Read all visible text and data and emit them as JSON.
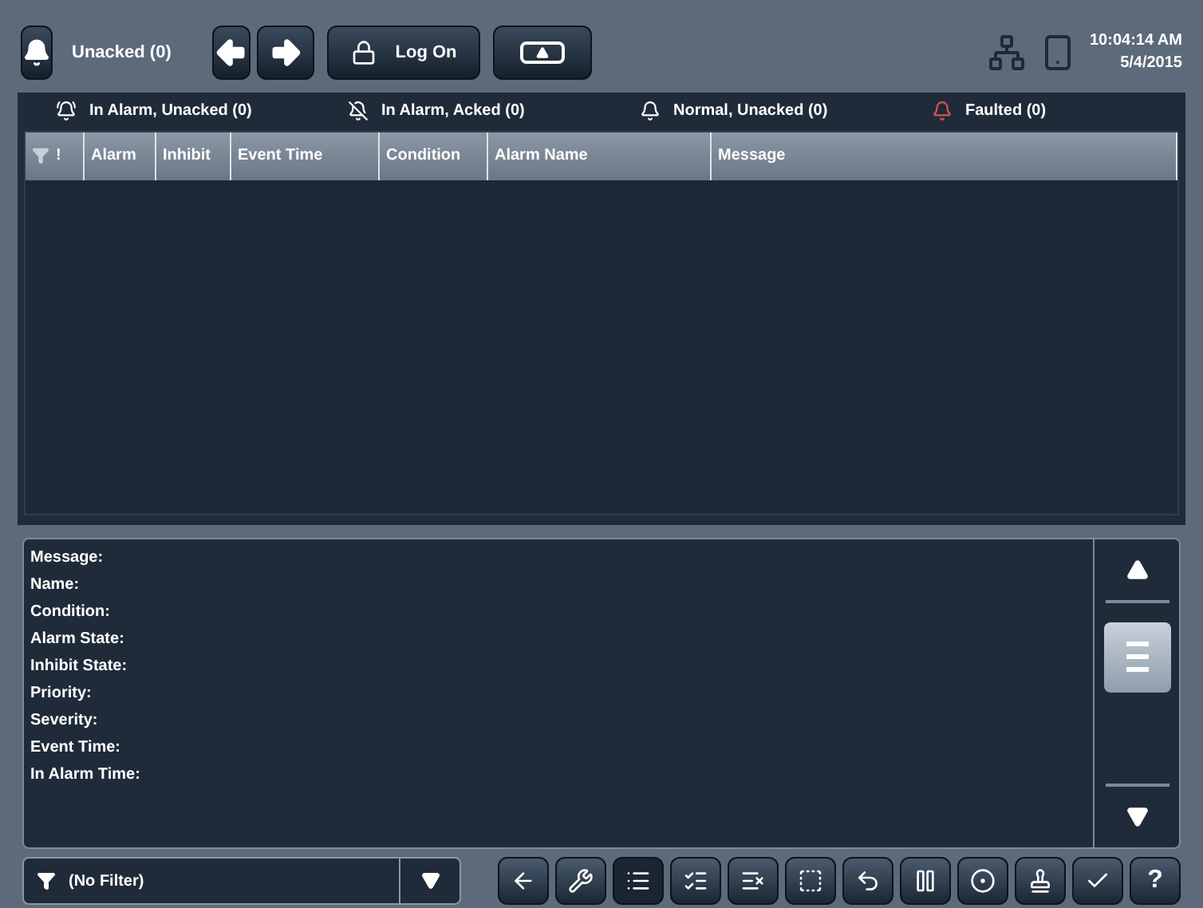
{
  "top_bar": {
    "unacked_label": "Unacked (0)",
    "log_on": "Log On",
    "time": "10:04:14 AM",
    "date": "5/4/2015"
  },
  "status_tabs": [
    {
      "label": "In Alarm, Unacked (0)",
      "kind": "unacked"
    },
    {
      "label": "In Alarm, Acked (0)",
      "kind": "acked"
    },
    {
      "label": "Normal, Unacked (0)",
      "kind": "normal"
    },
    {
      "label": "Faulted (0)",
      "kind": "faulted"
    }
  ],
  "table": {
    "columns": [
      "!",
      "Alarm",
      "Inhibit",
      "Event Time",
      "Condition",
      "Alarm Name",
      "Message"
    ]
  },
  "details": [
    "Message:",
    "Name:",
    "Condition:",
    "Alarm State:",
    "Inhibit State:",
    "Priority:",
    "Severity:",
    "Event Time:",
    "In Alarm Time:"
  ],
  "filter": {
    "value": "(No Filter)"
  },
  "toolbar": [
    {
      "selected": false
    },
    {
      "selected": false
    },
    {
      "selected": true
    },
    {
      "selected": false
    },
    {
      "selected": false
    },
    {
      "selected": false
    },
    {
      "selected": false
    },
    {
      "selected": false
    },
    {
      "selected": false
    },
    {
      "selected": false
    },
    {
      "selected": false
    },
    {
      "selected": false,
      "label": "?"
    }
  ]
}
